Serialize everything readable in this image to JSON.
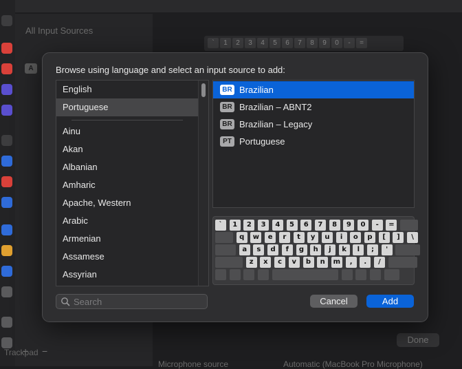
{
  "background": {
    "panel_title": "All Input Sources",
    "badge": "A",
    "add_symbol": "+",
    "remove_symbol": "−",
    "trackpad_label": "Trackpad",
    "done_label": "Done",
    "mic_label": "Microphone source",
    "mic_value": "Automatic (MacBook Pro Microphone)",
    "top_keys": [
      "`",
      "1",
      "2",
      "3",
      "4",
      "5",
      "6",
      "7",
      "8",
      "9",
      "0",
      "-",
      "="
    ],
    "sidebar_icons": [
      "speaker-icon",
      "bell-icon",
      "sound-icon",
      "moon-icon",
      "hourglass-icon",
      "lock-icon",
      "hand-icon",
      "fingerprint-icon",
      "people-icon",
      "at-icon",
      "photos-icon",
      "icloud-icon",
      "wallet-icon",
      "keyboard-icon",
      "trackpad-icon"
    ]
  },
  "sheet": {
    "title": "Browse using language and select an input source to add:",
    "languages_top": [
      "English",
      "Portuguese"
    ],
    "selected_language": "Portuguese",
    "languages": [
      "Ainu",
      "Akan",
      "Albanian",
      "Amharic",
      "Apache, Western",
      "Arabic",
      "Armenian",
      "Assamese",
      "Assyrian"
    ],
    "input_sources": [
      {
        "code": "BR",
        "label": "Brazilian",
        "selected": true
      },
      {
        "code": "BR",
        "label": "Brazilian – ABNT2",
        "selected": false
      },
      {
        "code": "BR",
        "label": "Brazilian – Legacy",
        "selected": false
      },
      {
        "code": "PT",
        "label": "Portuguese",
        "selected": false
      }
    ],
    "keyboard_rows": [
      [
        "`",
        "1",
        "2",
        "3",
        "4",
        "5",
        "6",
        "7",
        "8",
        "9",
        "0",
        "-",
        "=",
        ""
      ],
      [
        "",
        "q",
        "w",
        "e",
        "r",
        "t",
        "y",
        "u",
        "i",
        "o",
        "p",
        "[",
        "]",
        "\\"
      ],
      [
        "",
        "a",
        "s",
        "d",
        "f",
        "g",
        "h",
        "j",
        "k",
        "l",
        ";",
        "'",
        ""
      ],
      [
        "",
        "z",
        "x",
        "c",
        "v",
        "b",
        "n",
        "m",
        ",",
        ".",
        "/",
        ""
      ],
      [
        "",
        "",
        "",
        "",
        "",
        "",
        "",
        "",
        ""
      ]
    ],
    "search_placeholder": "Search",
    "cancel_label": "Cancel",
    "add_label": "Add"
  },
  "colors": {
    "accent": "#0a63d8",
    "sheet_bg": "#2e2e30",
    "list_bg": "#262628"
  }
}
